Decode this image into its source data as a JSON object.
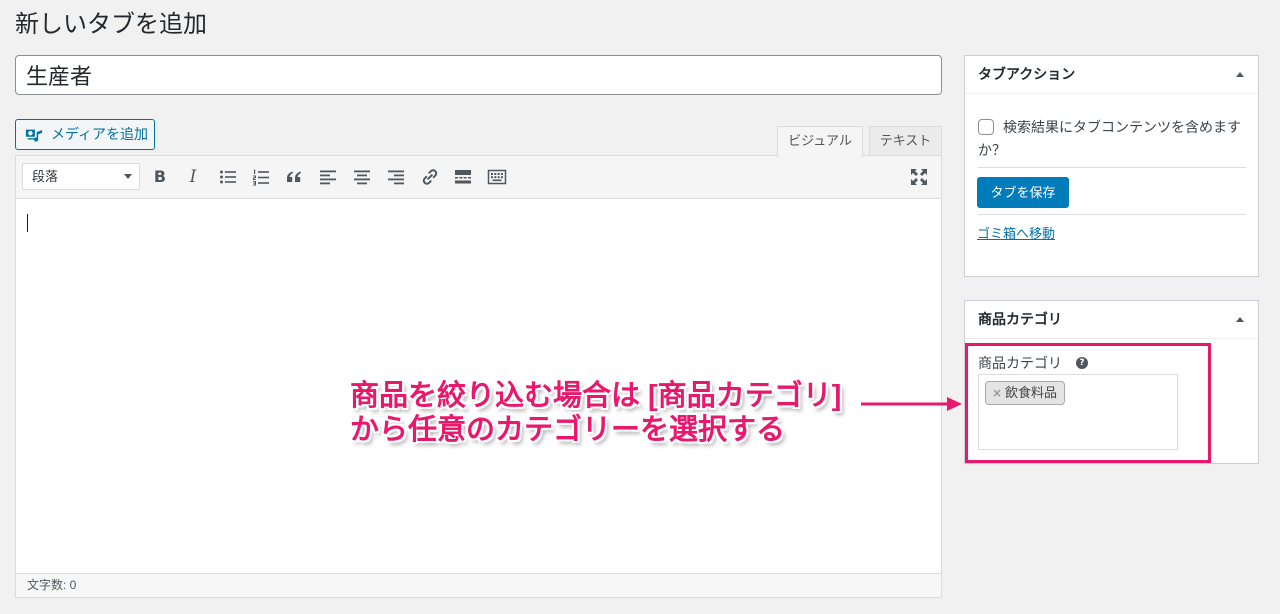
{
  "page": {
    "title": "新しいタブを追加"
  },
  "title_input": {
    "value": "生産者"
  },
  "media_button": {
    "label": "メディアを追加",
    "icon": "add-media-icon"
  },
  "editor": {
    "tabs": {
      "visual": "ビジュアル",
      "text": "テキスト",
      "active": "visual"
    },
    "format_select": {
      "value": "段落"
    },
    "toolbar": {
      "bold_glyph": "B",
      "italic_glyph": "I",
      "icons": [
        "bold-icon",
        "italic-icon",
        "bulleted-list-icon",
        "numbered-list-icon",
        "blockquote-icon",
        "align-left-icon",
        "align-center-icon",
        "align-right-icon",
        "link-icon",
        "read-more-icon",
        "toolbar-toggle-icon",
        "fullscreen-icon"
      ]
    },
    "word_count": "文字数: 0"
  },
  "sidebar": {
    "tab_actions": {
      "title": "タブアクション",
      "toggle_icon": "arrow-up-icon",
      "include_in_search": {
        "label": "検索結果にタブコンテンツを含めますか？",
        "checked": false
      },
      "save_button": "タブを保存",
      "trash_link": "ゴミ箱へ移動"
    },
    "product_category": {
      "title": "商品カテゴリ",
      "toggle_icon": "arrow-up-icon",
      "field_label": "商品カテゴリ",
      "help_glyph": "?",
      "selected": [
        {
          "remove_glyph": "×",
          "label": "飲食料品"
        }
      ]
    }
  },
  "annotation": {
    "line1": "商品を絞り込む場合は [商品カテゴリ]",
    "line2": "から任意のカテゴリーを選択する",
    "arrow_icon": "arrow-right-icon"
  },
  "colors": {
    "page_background": "#f1f1f1",
    "primary_button": "#007cba",
    "link": "#0073aa",
    "annotation": "#e8186d"
  }
}
